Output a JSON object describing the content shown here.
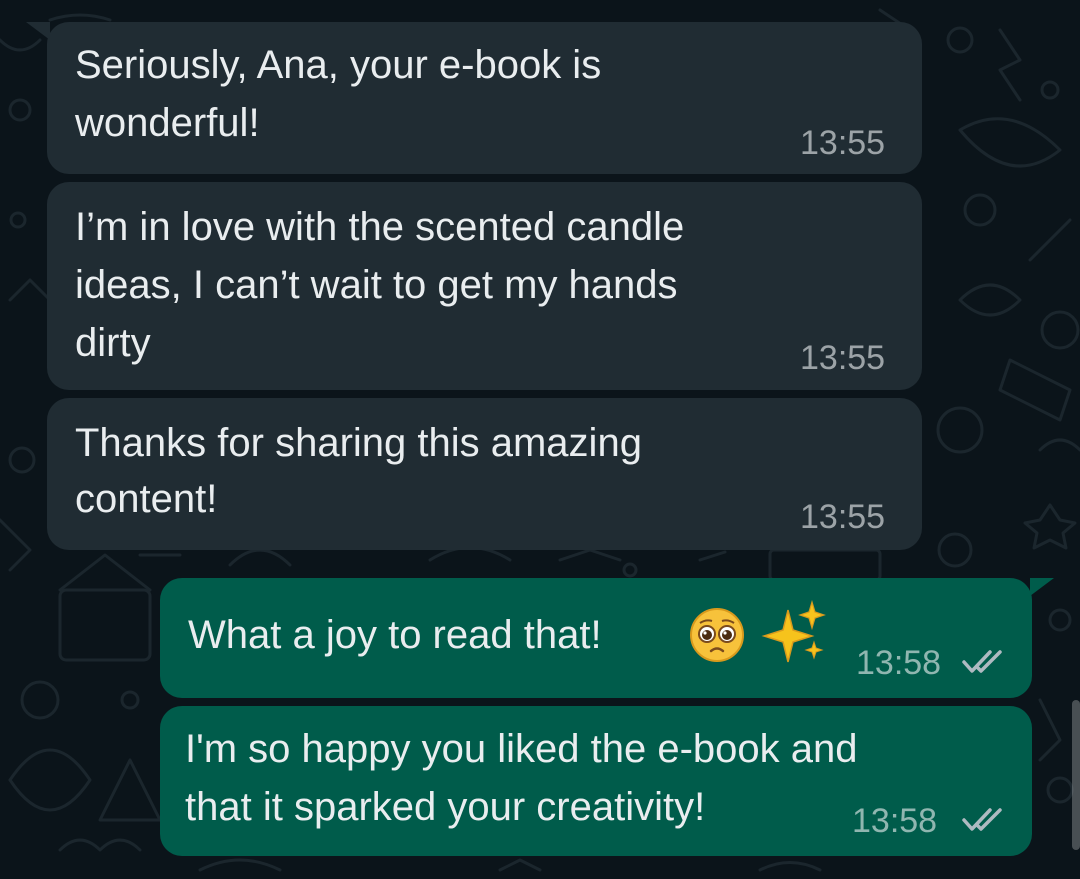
{
  "chat": {
    "background_color": "#0b141a",
    "incoming_color": "#202c33",
    "outgoing_color": "#005c4b",
    "messages": [
      {
        "direction": "incoming",
        "lines": [
          "Seriously, Ana, your e-book is",
          "wonderful!"
        ],
        "time": "13:55"
      },
      {
        "direction": "incoming",
        "lines": [
          "I’m in love with the scented candle",
          "ideas, I can’t wait to get my hands",
          "dirty"
        ],
        "time": "13:55"
      },
      {
        "direction": "incoming",
        "lines": [
          "Thanks for sharing this amazing",
          "content!"
        ],
        "time": "13:55"
      },
      {
        "direction": "outgoing",
        "lines": [
          "What a joy to read that!"
        ],
        "emojis": [
          "pleading-face-icon",
          "sparkles-icon"
        ],
        "time": "13:58",
        "status": "read-double-check-icon"
      },
      {
        "direction": "outgoing",
        "lines": [
          "I'm so happy you liked the e-book and",
          "that it sparked your creativity!"
        ],
        "time": "13:58",
        "status": "read-double-check-icon"
      }
    ]
  }
}
